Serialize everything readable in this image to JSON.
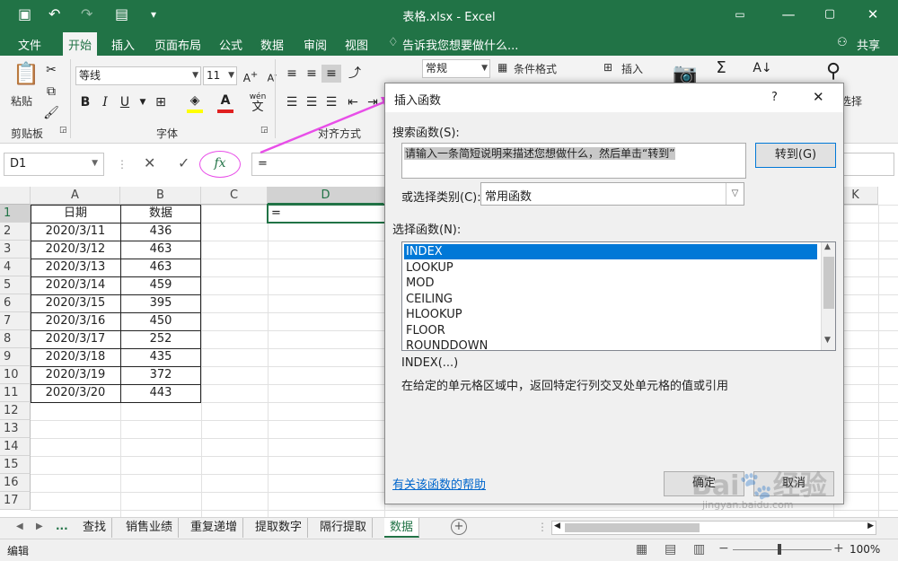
{
  "window": {
    "title": "表格.xlsx - Excel"
  },
  "menu": {
    "file": "文件",
    "home": "开始",
    "insert": "插入",
    "layout": "页面布局",
    "formulas": "公式",
    "data": "数据",
    "review": "审阅",
    "view": "视图",
    "tell_me": "告诉我您想要做什么...",
    "share": "共享"
  },
  "ribbon": {
    "paste": "粘贴",
    "clipboard": "剪贴板",
    "font_group": "字体",
    "align_group": "对齐方式",
    "font_name": "等线",
    "font_size": "11",
    "bold": "B",
    "italic": "I",
    "underline": "U",
    "wen": "wén",
    "wen2": "文",
    "number_format": "常规",
    "cond_format": "条件格式",
    "insert_cells": "插入",
    "select_label": "选择",
    "font_color": "#e02020",
    "fill_color": "#ffff00"
  },
  "formula_bar": {
    "name_box": "D1",
    "fx": "fx",
    "value": "="
  },
  "sheet": {
    "columns": [
      "A",
      "B",
      "C",
      "D",
      "K"
    ],
    "rows": [
      "1",
      "2",
      "3",
      "4",
      "5",
      "6",
      "7",
      "8",
      "9",
      "10",
      "11",
      "12",
      "13",
      "14",
      "15",
      "16",
      "17"
    ],
    "header": {
      "date": "日期",
      "data": "数据"
    },
    "records": [
      {
        "date": "2020/3/11",
        "value": "436"
      },
      {
        "date": "2020/3/12",
        "value": "463"
      },
      {
        "date": "2020/3/13",
        "value": "463"
      },
      {
        "date": "2020/3/14",
        "value": "459"
      },
      {
        "date": "2020/3/15",
        "value": "395"
      },
      {
        "date": "2020/3/16",
        "value": "450"
      },
      {
        "date": "2020/3/17",
        "value": "252"
      },
      {
        "date": "2020/3/18",
        "value": "435"
      },
      {
        "date": "2020/3/19",
        "value": "372"
      },
      {
        "date": "2020/3/20",
        "value": "443"
      }
    ],
    "d1_value": "="
  },
  "tabs": {
    "more": "...",
    "items": [
      "查找",
      "销售业绩",
      "重复递增",
      "提取数字",
      "隔行提取",
      "数据"
    ],
    "add": "+"
  },
  "status": {
    "mode": "编辑",
    "zoom": "100%"
  },
  "dialog": {
    "title": "插入函数",
    "help_q": "?",
    "close": "✕",
    "search_label": "搜索函数(S):",
    "search_value": "请输入一条简短说明来描述您想做什么，然后单击“转到”",
    "go_button": "转到(G)",
    "category_label": "或选择类别(C):",
    "category_value": "常用函数",
    "select_label": "选择函数(N):",
    "functions": [
      "INDEX",
      "LOOKUP",
      "MOD",
      "CEILING",
      "HLOOKUP",
      "FLOOR",
      "ROUNDDOWN"
    ],
    "signature": "INDEX(...)",
    "description": "在给定的单元格区域中，返回特定行列交叉处单元格的值或引用",
    "help_link": "有关该函数的帮助",
    "ok": "确定",
    "cancel": "取消"
  },
  "watermark": {
    "brand": "Bai",
    "brand2": "经验",
    "url": "jingyan.baidu.com"
  }
}
